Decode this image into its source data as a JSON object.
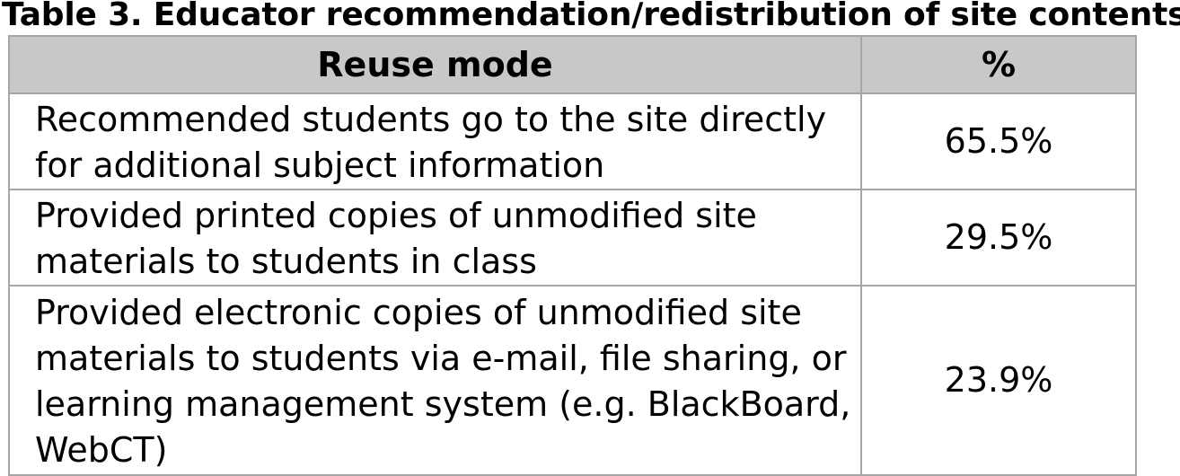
{
  "title": "Table 3. Educator recommendation/redistribution of site contents",
  "table": {
    "headers": [
      "Reuse mode",
      "%"
    ],
    "rows": [
      {
        "mode": "Recommended students go to the site directly for additional subject information",
        "percent": "65.5%"
      },
      {
        "mode": "Provided printed copies of unmodified site materials to students in class",
        "percent": "29.5%"
      },
      {
        "mode": "Provided electronic copies of unmodified site materials to students via e-mail, file sharing, or learning management system (e.g. BlackBoard, WebCT)",
        "percent": "23.9%"
      }
    ]
  }
}
